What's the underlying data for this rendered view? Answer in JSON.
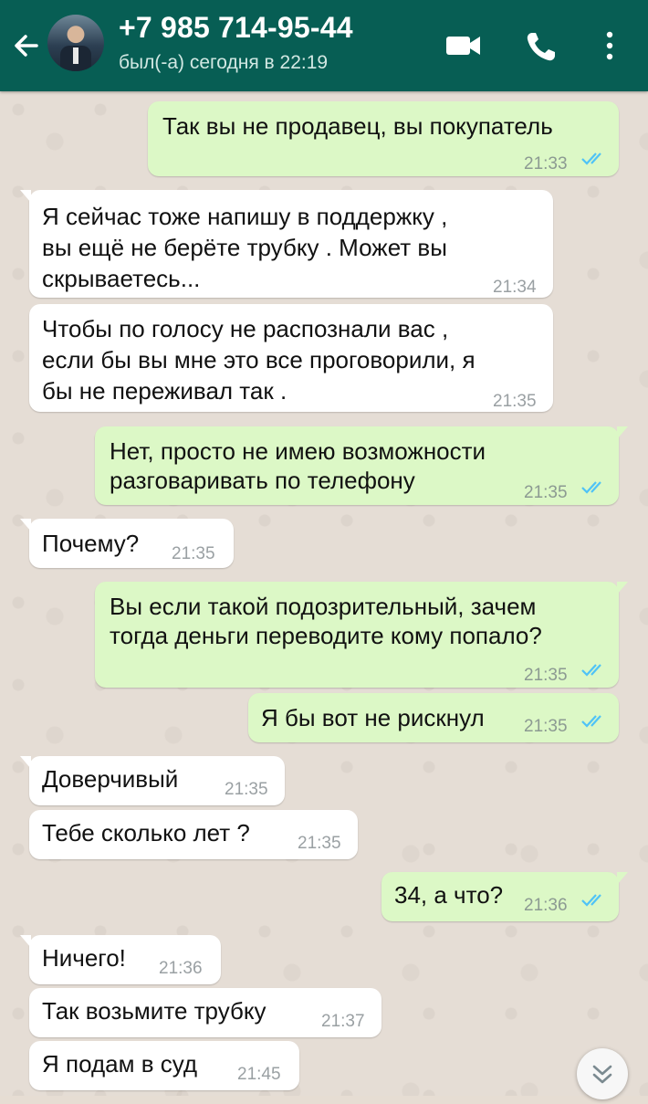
{
  "header": {
    "contact_title": "+7 985 714-95-44",
    "last_seen": "был(-а) сегодня в 22:19",
    "colors": {
      "bar": "#075e54",
      "outgoing_bubble": "#dcf8c6",
      "incoming_bubble": "#ffffff",
      "read_ticks": "#4fc3f7"
    },
    "icons": [
      "back-arrow-icon",
      "video-call-icon",
      "phone-icon",
      "more-vert-icon"
    ]
  },
  "messages": [
    {
      "dir": "out",
      "text": "Так вы не продавец, вы покупатель",
      "time": "21:33",
      "read": true
    },
    {
      "dir": "in",
      "lines": [
        "Я сейчас тоже напишу в поддержку ,",
        "вы ещё не берёте трубку . Может вы",
        "скрываетесь..."
      ],
      "time": "21:34"
    },
    {
      "dir": "in",
      "lines": [
        "Чтобы по голосу не распознали вас ,",
        "если бы вы мне это все проговорили, я",
        "бы не переживал так ."
      ],
      "time": "21:35"
    },
    {
      "dir": "out",
      "lines": [
        "Нет, просто не имею возможности",
        "разговаривать по телефону"
      ],
      "time": "21:35",
      "read": true
    },
    {
      "dir": "in",
      "text": "Почему?",
      "time": "21:35"
    },
    {
      "dir": "out",
      "lines": [
        "Вы если такой подозрительный, зачем",
        "тогда деньги переводите кому попало?"
      ],
      "time": "21:35",
      "read": true
    },
    {
      "dir": "out",
      "text": "Я бы вот не рискнул",
      "time": "21:35",
      "read": true
    },
    {
      "dir": "in",
      "text": "Доверчивый",
      "time": "21:35"
    },
    {
      "dir": "in",
      "text": "Тебе сколько лет ?",
      "time": "21:35"
    },
    {
      "dir": "out",
      "text": "34, а что?",
      "time": "21:36",
      "read": true
    },
    {
      "dir": "in",
      "text": "Ничего!",
      "time": "21:36"
    },
    {
      "dir": "in",
      "text": "Так возьмите трубку",
      "time": "21:37"
    },
    {
      "dir": "in",
      "text": "Я подам в суд",
      "time": "21:45"
    }
  ],
  "scroll_button": {
    "icon": "double-chevron-down-icon"
  }
}
